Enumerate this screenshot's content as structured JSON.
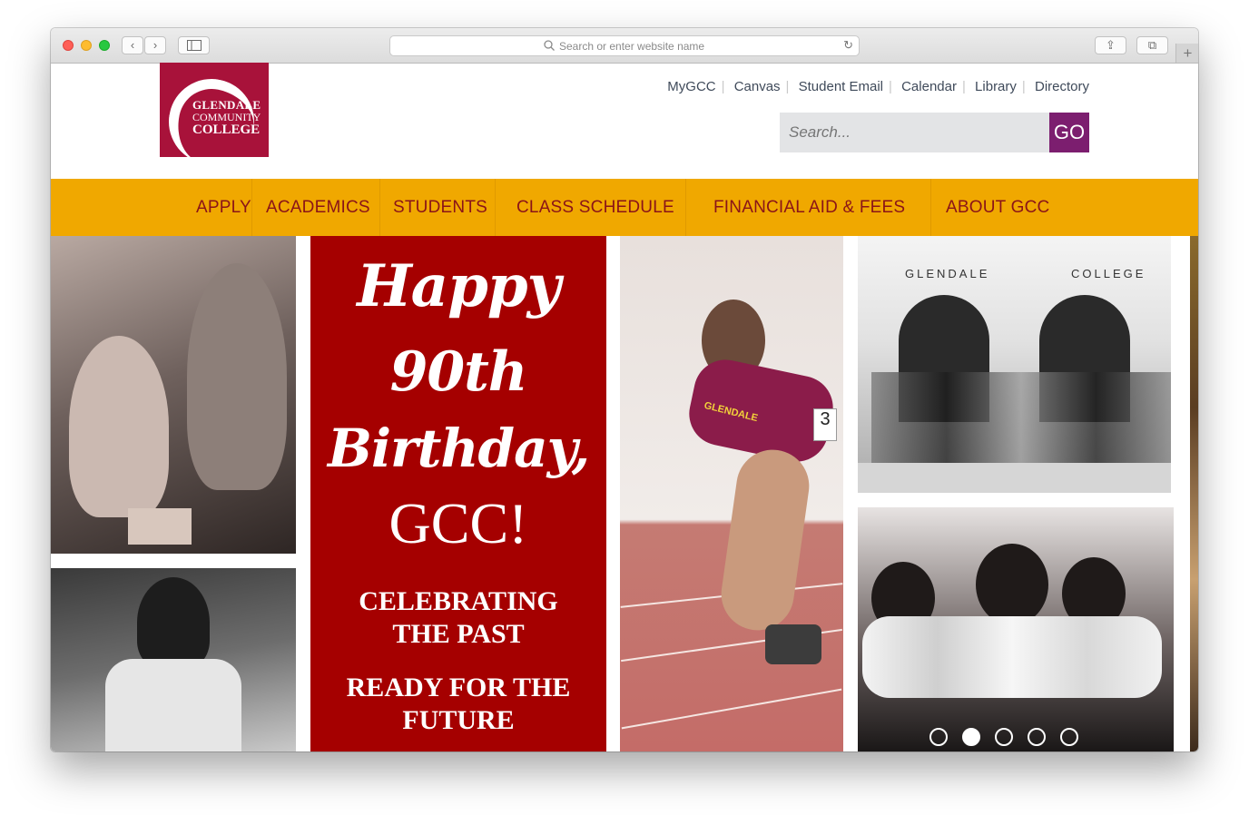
{
  "browser": {
    "url_placeholder": "Search or enter website name",
    "back_glyph": "‹",
    "forward_glyph": "›",
    "reload_glyph": "↻",
    "share_glyph": "⇪",
    "tabs_glyph": "⧉",
    "new_tab_glyph": "+"
  },
  "logo": {
    "line1": "GLENDALE",
    "line2": "COMMUNITY",
    "line3": "COLLEGE"
  },
  "utility_links": [
    "MyGCC",
    "Canvas",
    "Student Email",
    "Calendar",
    "Library",
    "Directory"
  ],
  "search": {
    "placeholder": "Search...",
    "button": "GO"
  },
  "nav": [
    "APPLY",
    "ACADEMICS",
    "STUDENTS",
    "CLASS SCHEDULE",
    "FINANCIAL AID & FEES",
    "ABOUT GCC"
  ],
  "hero": {
    "script_line1": "Happy",
    "script_line2": "90th",
    "script_line3": "Birthday,",
    "gcc": "GCC!",
    "tag1_line1": "CELEBRATING",
    "tag1_line2": "THE PAST",
    "tag2_line1": "READY FOR THE",
    "tag2_line2": "FUTURE",
    "building_sign_left": "GLENDALE",
    "building_sign_right": "COLLEGE",
    "bib_number": "3",
    "jersey_text": "GLENDALE"
  },
  "slider": {
    "count": 5,
    "active_index": 1
  },
  "colors": {
    "brand_red": "#a8123a",
    "nav_gold": "#f0a800",
    "nav_text": "#8a1418",
    "go_purple": "#7c1e6f",
    "hero_red": "#a50000"
  }
}
